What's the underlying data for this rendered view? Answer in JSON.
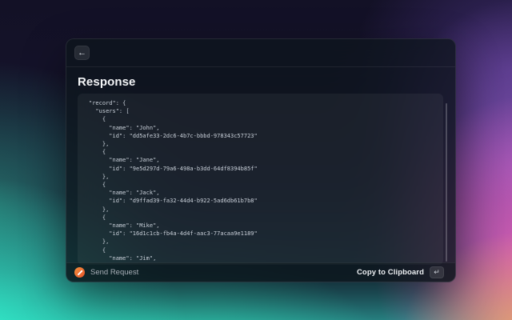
{
  "colors": {
    "accent_orange": "#ee6e2d",
    "bg_navy": "#131126",
    "bg_turquoise": "#31f4d0",
    "bg_pink": "#ee5fbc",
    "bg_purple": "#46307a",
    "panel_bg": "#0d151c"
  },
  "panel": {
    "back_icon_glyph": "←",
    "title": "Response",
    "code": {
      "lines": [
        "\"record\": {",
        "  \"users\": [",
        "    {",
        "      \"name\": \"John\",",
        "      \"id\": \"dd5afe33-2dc6-4b7c-bbbd-978343c57723\"",
        "    },",
        "    {",
        "      \"name\": \"Jane\",",
        "      \"id\": \"9e5d297d-79a6-498a-b3dd-64df8394b85f\"",
        "    },",
        "    {",
        "      \"name\": \"Jack\",",
        "      \"id\": \"d9ffad39-fa32-44d4-b922-5ad6db61b7b8\"",
        "    },",
        "    {",
        "      \"name\": \"Mike\",",
        "      \"id\": \"16d1c1cb-fb4a-4d4f-aac3-77acaa9e1189\"",
        "    },",
        "    {",
        "      \"name\": \"Jim\","
      ]
    },
    "footer": {
      "send_label": "Send Request",
      "copy_label": "Copy to Clipboard",
      "return_key_glyph": "↵"
    }
  }
}
